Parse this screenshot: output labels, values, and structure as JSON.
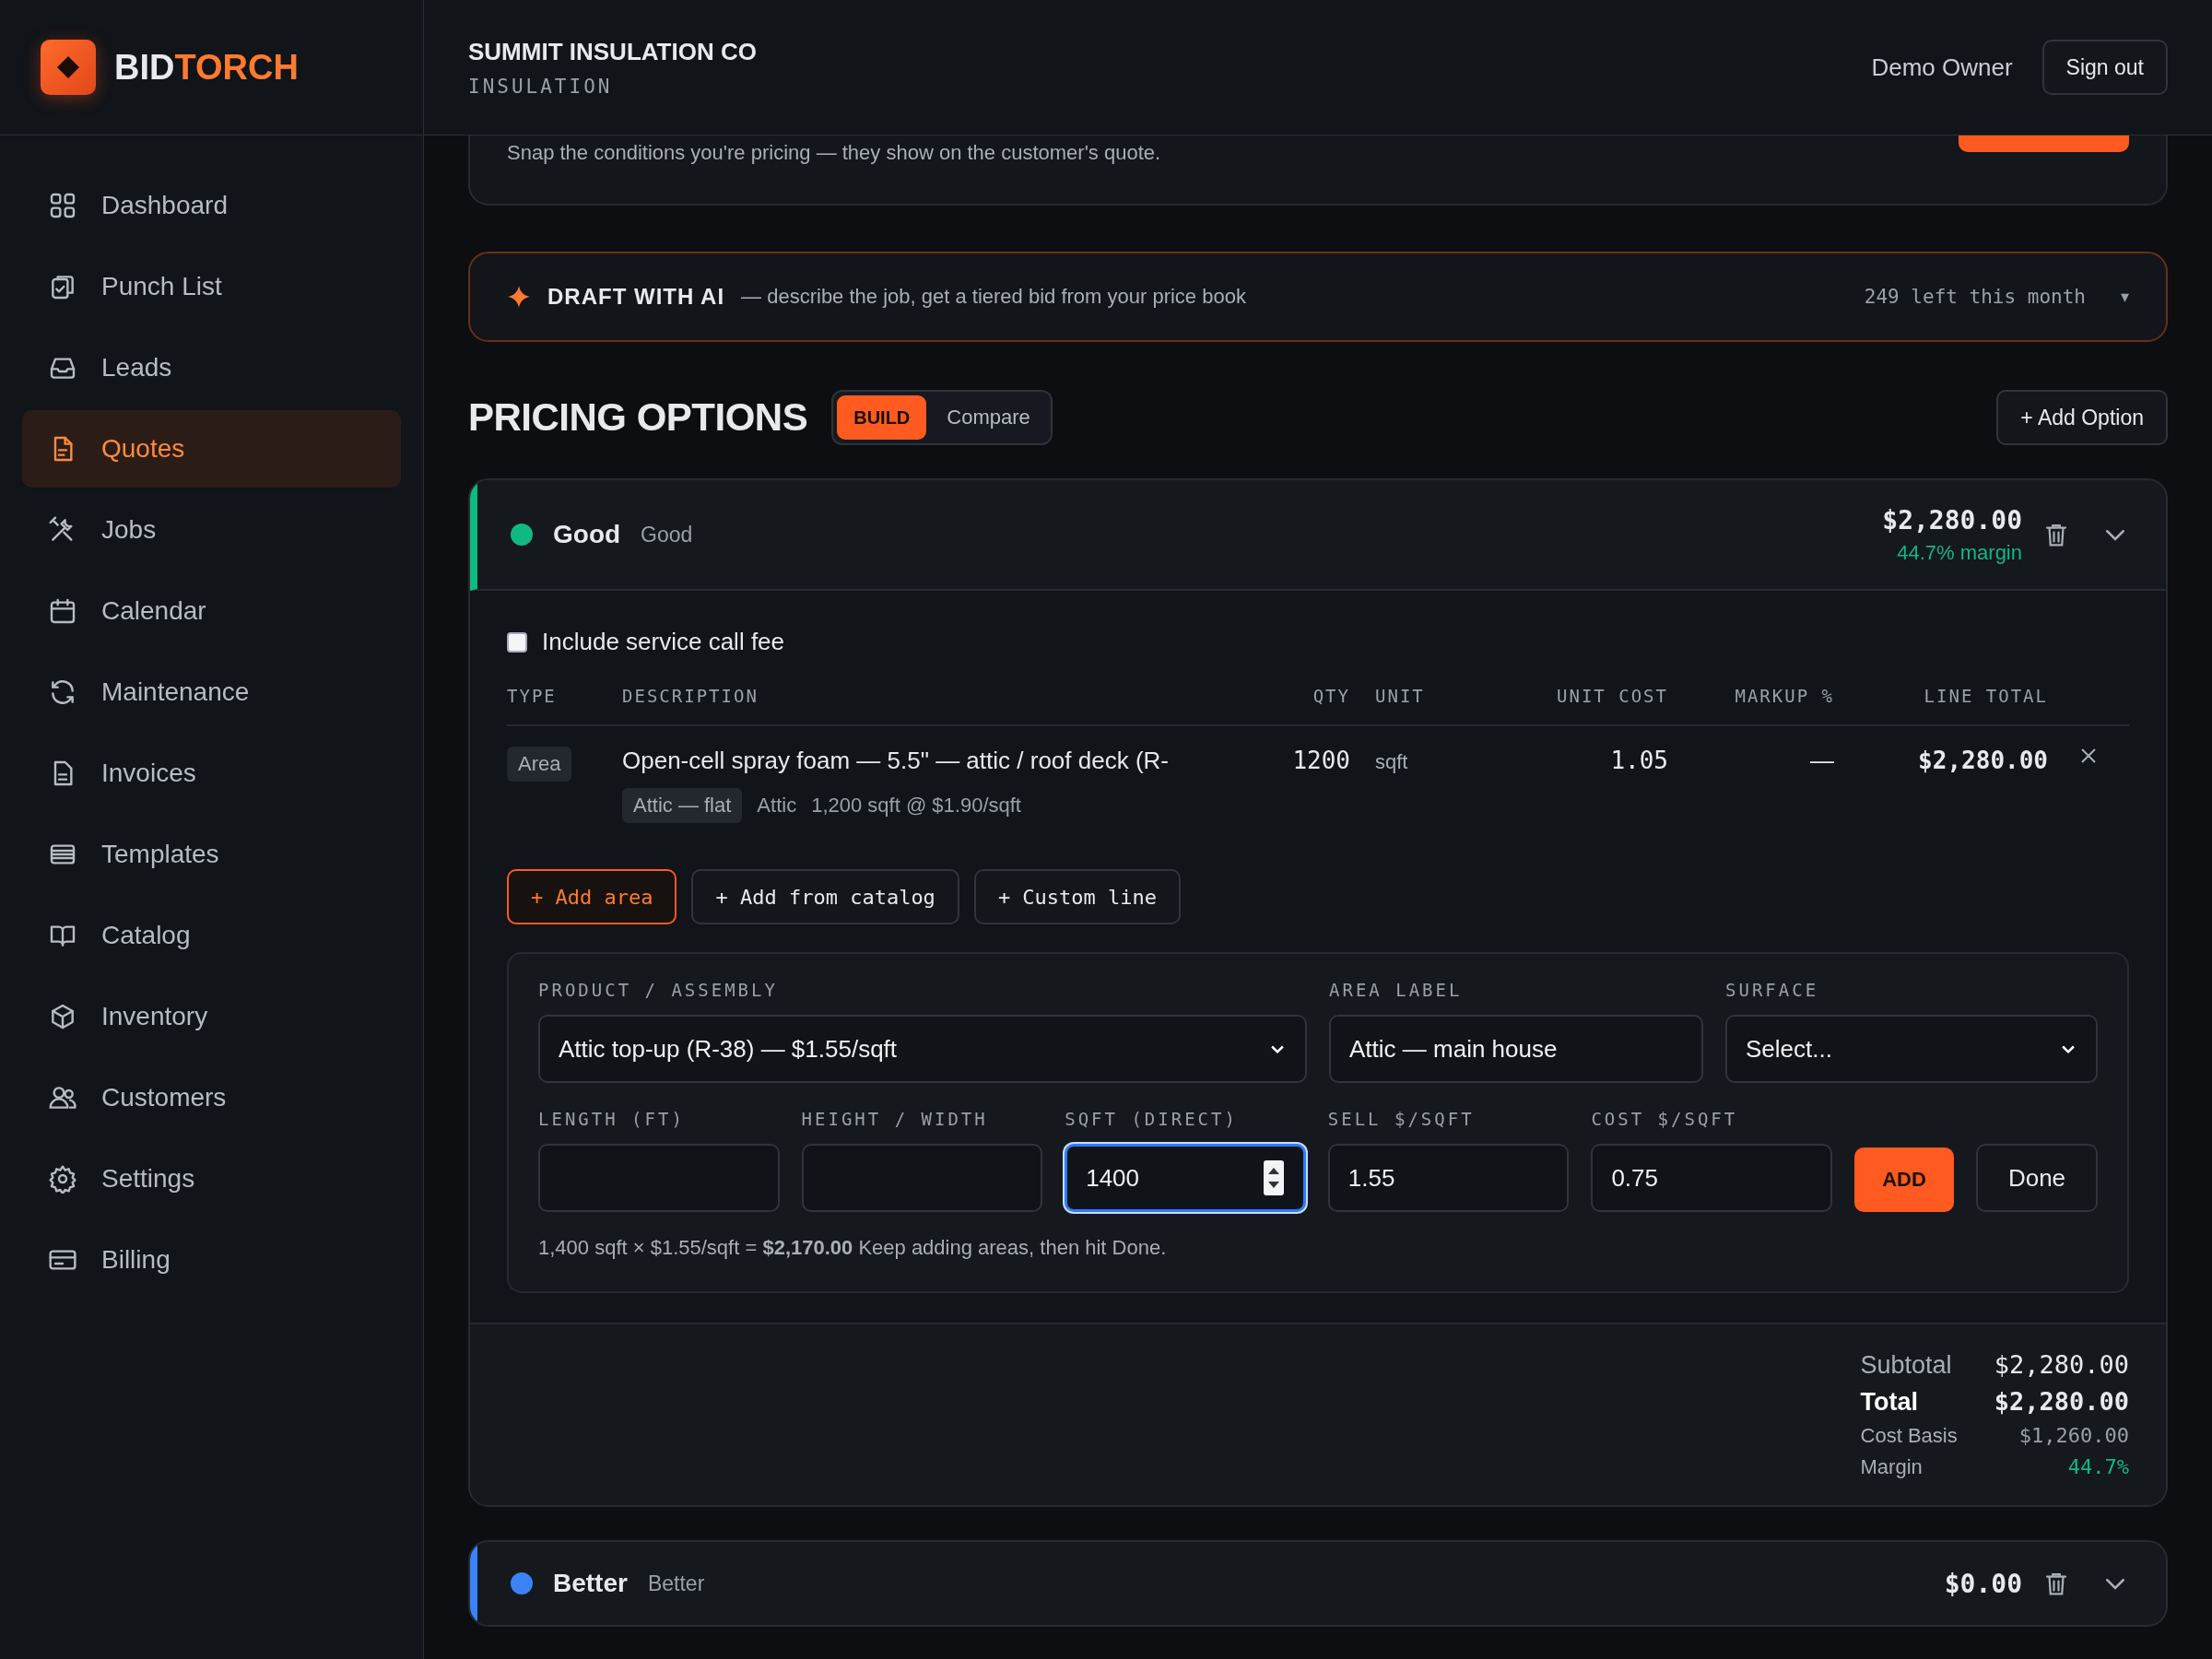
{
  "brand": {
    "name_lead": "BID",
    "name_accent": "TORCH"
  },
  "header": {
    "company": "SUMMIT INSULATION CO",
    "trade": "INSULATION",
    "user": "Demo Owner",
    "sign_out": "Sign out"
  },
  "sidebar": {
    "items": [
      {
        "label": "Dashboard",
        "selected": false
      },
      {
        "label": "Punch List",
        "selected": false
      },
      {
        "label": "Leads",
        "selected": false
      },
      {
        "label": "Quotes",
        "selected": true
      },
      {
        "label": "Jobs",
        "selected": false
      },
      {
        "label": "Calendar",
        "selected": false
      },
      {
        "label": "Maintenance",
        "selected": false
      },
      {
        "label": "Invoices",
        "selected": false
      },
      {
        "label": "Templates",
        "selected": false
      },
      {
        "label": "Catalog",
        "selected": false
      },
      {
        "label": "Inventory",
        "selected": false
      },
      {
        "label": "Customers",
        "selected": false
      },
      {
        "label": "Settings",
        "selected": false
      },
      {
        "label": "Billing",
        "selected": false
      }
    ]
  },
  "photo_card": {
    "hint": "Snap the conditions you're pricing — they show on the customer's quote."
  },
  "ai_draft": {
    "title": "DRAFT WITH AI",
    "description": "— describe the job, get a tiered bid from your price book",
    "remaining": "249 left this month",
    "toggle": "▾"
  },
  "pricing": {
    "title": "PRICING OPTIONS",
    "modes": [
      {
        "label": "BUILD",
        "selected": true
      },
      {
        "label": "Compare",
        "selected": false
      }
    ],
    "add_option": "+ Add Option"
  },
  "options": [
    {
      "name": "Good",
      "tier": "Good",
      "color": "#10b981",
      "price": "$2,280.00",
      "margin": "44.7% margin",
      "expanded": true,
      "service_fee": {
        "label": "Include service call fee",
        "checked": false
      },
      "columns": [
        "TYPE",
        "DESCRIPTION",
        "QTY",
        "UNIT",
        "UNIT COST",
        "MARKUP %",
        "LINE TOTAL"
      ],
      "rows": [
        {
          "type": "Area",
          "description": "Open-cell spray foam — 5.5\" — attic / roof deck (R-",
          "tag": "Attic — flat",
          "area": "Attic",
          "measure": "1,200 sqft @ $1.90/sqft",
          "qty": "1200",
          "unit": "sqft",
          "unit_cost": "1.05",
          "markup": "—",
          "line_total": "$2,280.00"
        }
      ],
      "actions": [
        {
          "label": "+ Add area",
          "selected": true
        },
        {
          "label": "+ Add from catalog",
          "selected": false
        },
        {
          "label": "+ Custom line",
          "selected": false
        }
      ],
      "area_form": {
        "fields": [
          {
            "label": "PRODUCT / ASSEMBLY",
            "kind": "select",
            "value": "Attic top-up (R-38) — $1.55/sqft",
            "focused": false
          },
          {
            "label": "AREA LABEL",
            "kind": "text",
            "value": "Attic — main house",
            "focused": false
          },
          {
            "label": "SURFACE",
            "kind": "select",
            "value": "Select...",
            "focused": false
          },
          {
            "label": "LENGTH (FT)",
            "kind": "text",
            "focused": false
          },
          {
            "label": "HEIGHT / WIDTH",
            "kind": "text",
            "focused": false
          },
          {
            "label": "SQFT (DIRECT)",
            "kind": "number",
            "value": "1400",
            "focused": true
          },
          {
            "label": "SELL $/SQFT",
            "kind": "text",
            "value": "1.55",
            "focused": false
          },
          {
            "label": "COST $/SQFT",
            "kind": "text",
            "value": "0.75",
            "focused": false
          }
        ],
        "add": "ADD",
        "done": "Done",
        "summary": "1,400 sqft × $1.55/sqft = **$2,170.00** Keep adding areas, then hit Done."
      },
      "totals": [
        {
          "label": "Subtotal",
          "value": "$2,280.00",
          "kind": "subtotal"
        },
        {
          "label": "Total",
          "value": "$2,280.00",
          "kind": "total"
        },
        {
          "label": "Cost Basis",
          "value": "$1,260.00",
          "kind": "detail"
        },
        {
          "label": "Margin",
          "value": "44.7%",
          "kind": "margin"
        }
      ]
    },
    {
      "name": "Better",
      "tier": "Better",
      "color": "#3b82f6",
      "price": "$0.00",
      "expanded": false
    }
  ]
}
